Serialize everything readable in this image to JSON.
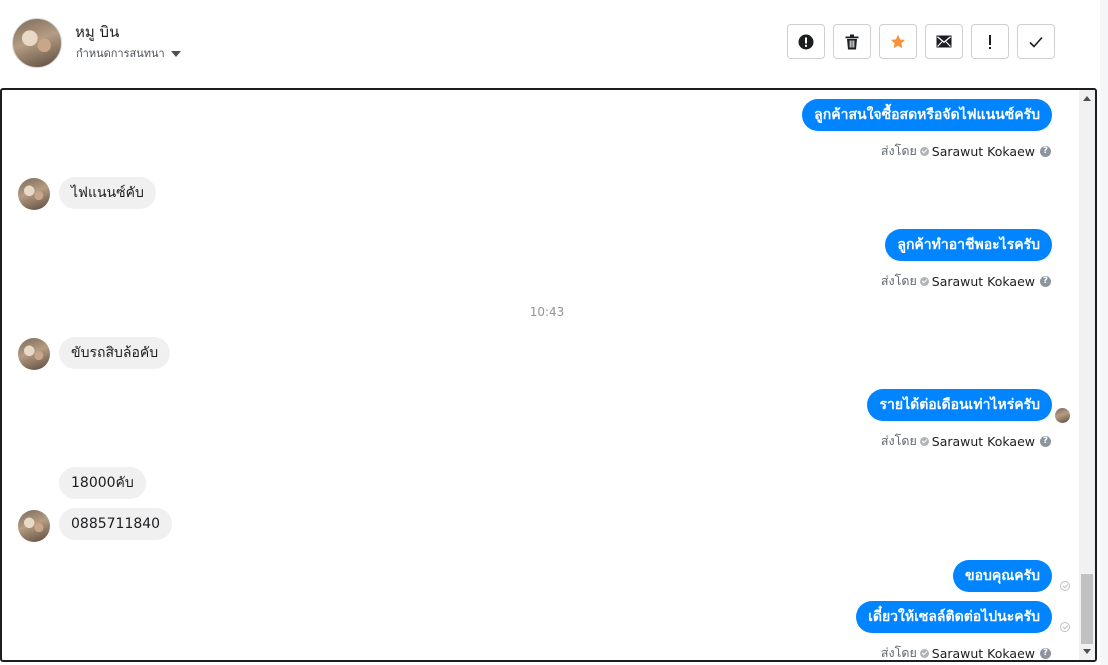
{
  "header": {
    "contact_name": "หมู บิน",
    "assign_label": "กำหนดการสนทนา",
    "toolbar": [
      {
        "name": "spam-button",
        "icon": "alert-circle-icon"
      },
      {
        "name": "delete-button",
        "icon": "trash-icon"
      },
      {
        "name": "star-button",
        "icon": "star-icon"
      },
      {
        "name": "mark-unread-button",
        "icon": "envelope-icon"
      },
      {
        "name": "follow-up-button",
        "icon": "exclamation-icon"
      },
      {
        "name": "mark-done-button",
        "icon": "check-icon"
      }
    ],
    "star_color": "#f7923a"
  },
  "conversation": {
    "sent_by_label": "ส่งโดย",
    "agent_name": "Sarawut Kokaew",
    "timestamp": "10:43",
    "messages": [
      {
        "direction": "out",
        "text": "ลูกค้าสนใจซื้อสดหรือจัดไฟแนนซ์ครับ"
      },
      {
        "direction": "in",
        "text": "ไฟแนนซ์คับ"
      },
      {
        "direction": "out",
        "text": "ลูกค้าทำอาชีพอะไรครับ"
      },
      {
        "direction": "in",
        "text": "ขับรถสิบล้อคับ"
      },
      {
        "direction": "out",
        "text": "รายได้ต่อเดือนเท่าไหร่ครับ"
      },
      {
        "direction": "in",
        "text": "18000คับ"
      },
      {
        "direction": "in",
        "text": "0885711840"
      },
      {
        "direction": "out",
        "text": "ขอบคุณครับ"
      },
      {
        "direction": "out",
        "text": "เดี๋ยวให้เซลล์ติดต่อไปนะครับ"
      }
    ]
  },
  "colors": {
    "outgoing_bubble": "#0084ff",
    "incoming_bubble": "#f1f0f0"
  }
}
